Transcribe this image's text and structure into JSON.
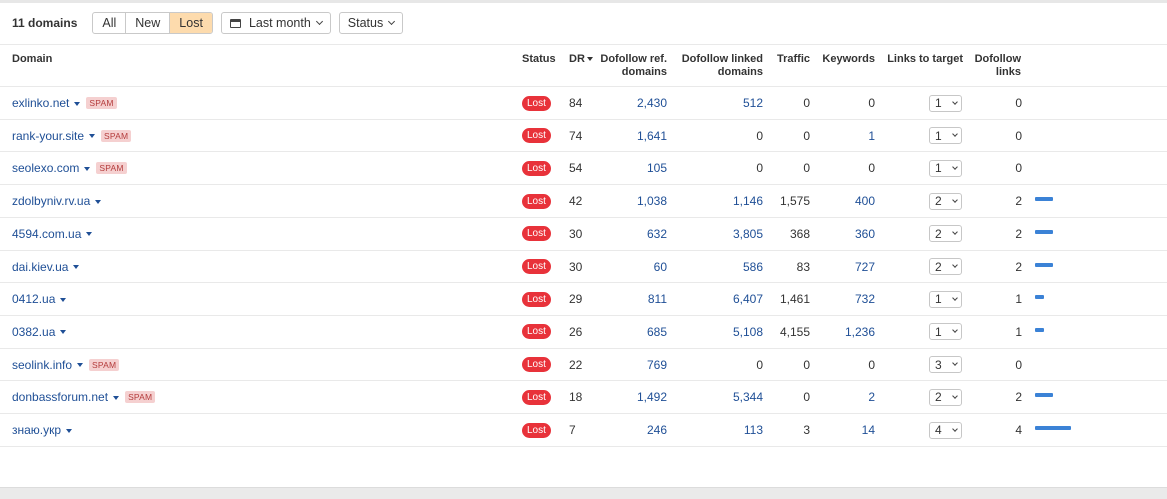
{
  "toolbar": {
    "count": "11 domains",
    "filters": [
      "All",
      "New",
      "Lost"
    ],
    "active_filter": "Lost",
    "date_filter": "Last month",
    "status_filter": "Status"
  },
  "headers": {
    "domain": "Domain",
    "status": "Status",
    "dr": "DR",
    "dofollow_ref_1": "Dofollow ref.",
    "dofollow_ref_2": "domains",
    "dofollow_linked_1": "Dofollow linked",
    "dofollow_linked_2": "domains",
    "traffic": "Traffic",
    "keywords": "Keywords",
    "links_to_target": "Links to target",
    "dofollow_links_1": "Dofollow",
    "dofollow_links_2": "links"
  },
  "rows": [
    {
      "domain": "exlinko.net",
      "spam": "SPAM",
      "status": "Lost",
      "dr": "84",
      "ref": "2,430",
      "linked": "512",
      "traffic": "0",
      "keywords": "0",
      "links": "1",
      "dofollow": "0",
      "bar": 0
    },
    {
      "domain": "rank-your.site",
      "spam": "SPAM",
      "status": "Lost",
      "dr": "74",
      "ref": "1,641",
      "linked": "0",
      "traffic": "0",
      "keywords": "1",
      "links": "1",
      "dofollow": "0",
      "bar": 0
    },
    {
      "domain": "seolexo.com",
      "spam": "SPAM",
      "status": "Lost",
      "dr": "54",
      "ref": "105",
      "linked": "0",
      "traffic": "0",
      "keywords": "0",
      "links": "1",
      "dofollow": "0",
      "bar": 0
    },
    {
      "domain": "zdolbyniv.rv.ua",
      "spam": "",
      "status": "Lost",
      "dr": "42",
      "ref": "1,038",
      "linked": "1,146",
      "traffic": "1,575",
      "keywords": "400",
      "links": "2",
      "dofollow": "2",
      "bar": 2
    },
    {
      "domain": "4594.com.ua",
      "spam": "",
      "status": "Lost",
      "dr": "30",
      "ref": "632",
      "linked": "3,805",
      "traffic": "368",
      "keywords": "360",
      "links": "2",
      "dofollow": "2",
      "bar": 2
    },
    {
      "domain": "dai.kiev.ua",
      "spam": "",
      "status": "Lost",
      "dr": "30",
      "ref": "60",
      "linked": "586",
      "traffic": "83",
      "keywords": "727",
      "links": "2",
      "dofollow": "2",
      "bar": 2
    },
    {
      "domain": "0412.ua",
      "spam": "",
      "status": "Lost",
      "dr": "29",
      "ref": "811",
      "linked": "6,407",
      "traffic": "1,461",
      "keywords": "732",
      "links": "1",
      "dofollow": "1",
      "bar": 1
    },
    {
      "domain": "0382.ua",
      "spam": "",
      "status": "Lost",
      "dr": "26",
      "ref": "685",
      "linked": "5,108",
      "traffic": "4,155",
      "keywords": "1,236",
      "links": "1",
      "dofollow": "1",
      "bar": 1
    },
    {
      "domain": "seolink.info",
      "spam": "SPAM",
      "status": "Lost",
      "dr": "22",
      "ref": "769",
      "linked": "0",
      "traffic": "0",
      "keywords": "0",
      "links": "3",
      "dofollow": "0",
      "bar": 0
    },
    {
      "domain": "donbassforum.net",
      "spam": "SPAM",
      "status": "Lost",
      "dr": "18",
      "ref": "1,492",
      "linked": "5,344",
      "traffic": "0",
      "keywords": "2",
      "links": "2",
      "dofollow": "2",
      "bar": 2
    },
    {
      "domain": "знаю.укр",
      "spam": "",
      "status": "Lost",
      "dr": "7",
      "ref": "246",
      "linked": "113",
      "traffic": "3",
      "keywords": "14",
      "links": "4",
      "dofollow": "4",
      "bar": 4
    }
  ],
  "colors": {
    "link": "#1f4f96",
    "lost_badge": "#e8323a",
    "spam_bg": "#f5d0d0",
    "active_filter": "#fddbad",
    "bar": "#3b82d6"
  }
}
